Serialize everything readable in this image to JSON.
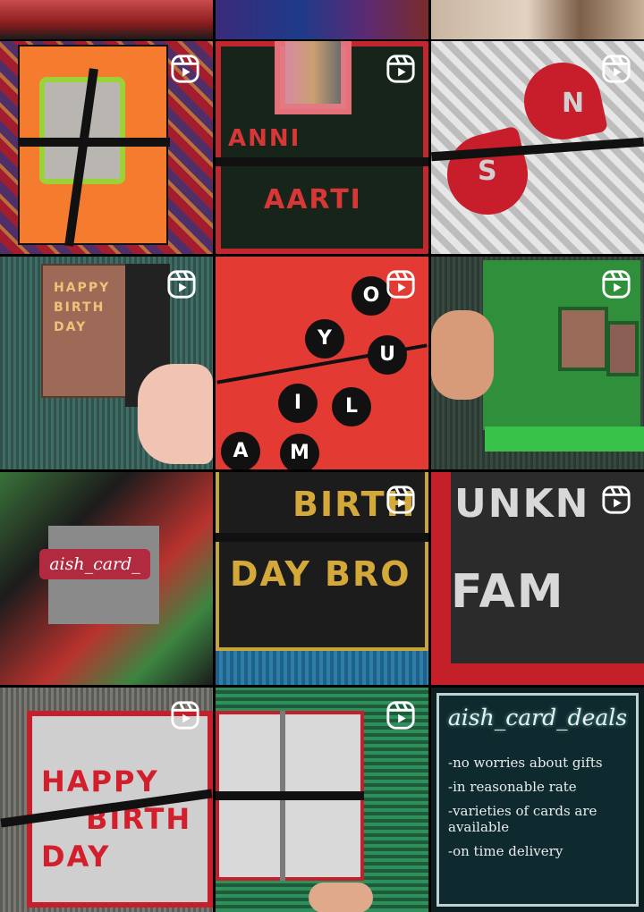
{
  "grid": {
    "reel_icon": "reel-icon",
    "tiles": [
      {
        "name": "tile-anniversary-photo-card",
        "kind": "reel"
      },
      {
        "name": "tile-anniversary-aarti-card",
        "kind": "reel",
        "text": "ANNIVERSARY AARTI"
      },
      {
        "name": "tile-heart-card",
        "kind": "reel",
        "text": "N S"
      },
      {
        "name": "tile-happy-birthday-brown",
        "kind": "reel",
        "text": "HAPPY BIRTH DAY"
      },
      {
        "name": "tile-red-circle-letters",
        "kind": "reel",
        "text": "Y O U L M I A"
      },
      {
        "name": "tile-green-popup-card",
        "kind": "reel"
      },
      {
        "name": "tile-aish-card-collage",
        "kind": "image",
        "text": "aish_card_"
      },
      {
        "name": "tile-birthday-bro-card",
        "kind": "reel",
        "text": "BIRTH DAY BRO"
      },
      {
        "name": "tile-unknown-family-card",
        "kind": "reel",
        "text": "UNKN FAM"
      },
      {
        "name": "tile-happy-birthday-silver",
        "kind": "reel",
        "text": "HAPPY BIRTH DAY"
      },
      {
        "name": "tile-silver-ribbon-card",
        "kind": "reel"
      },
      {
        "name": "tile-aish-card-deals-info",
        "kind": "text"
      }
    ]
  },
  "deals": {
    "brand": "aish_card_deals",
    "points": [
      "-no worries about gifts",
      "-in reasonable rate",
      "-varieties of cards are available",
      "-on time delivery"
    ]
  },
  "colors": {
    "background": "#000000",
    "panel": "#0f2a2e",
    "red": "#d21f2b",
    "orange": "#f57c2e",
    "green": "#2f8f3a",
    "glitter_gold": "#d4a93a",
    "glitter_silver": "#d8d8d8"
  }
}
